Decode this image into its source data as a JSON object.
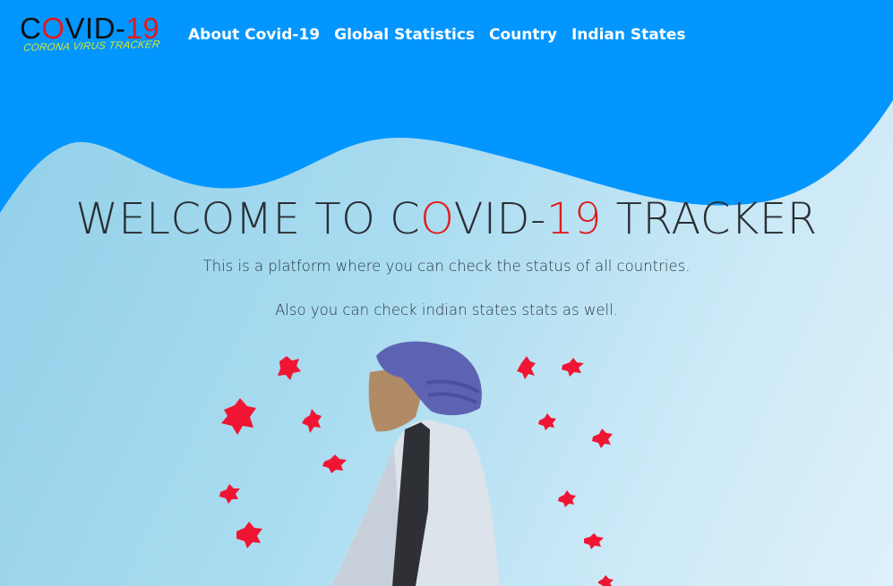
{
  "logo": {
    "main_part1": "C",
    "main_part2": "O",
    "main_part3": "VID-",
    "main_part4": "19",
    "tagline": "CORONA VIRUS TRACKER"
  },
  "nav": {
    "items": [
      {
        "label": "About Covid-19"
      },
      {
        "label": "Global Statistics"
      },
      {
        "label": "Country"
      },
      {
        "label": "Indian States"
      }
    ]
  },
  "hero": {
    "title_part1": "WELCOME TO C",
    "title_part2": "O",
    "title_part3": "VID-",
    "title_part4": "19",
    "title_part5": " TRACKER",
    "line1": "This is a platform where you can check the status of all countries.",
    "line2": "Also you can check indian states stats as well."
  },
  "colors": {
    "nav_blue": "#0396ff",
    "accent_red": "#e01b1b",
    "virus_red": "#f01633",
    "turban": "#5d63b3",
    "skin": "#b18a66",
    "coat": "#dde3ea",
    "shirt": "#2f3035"
  }
}
